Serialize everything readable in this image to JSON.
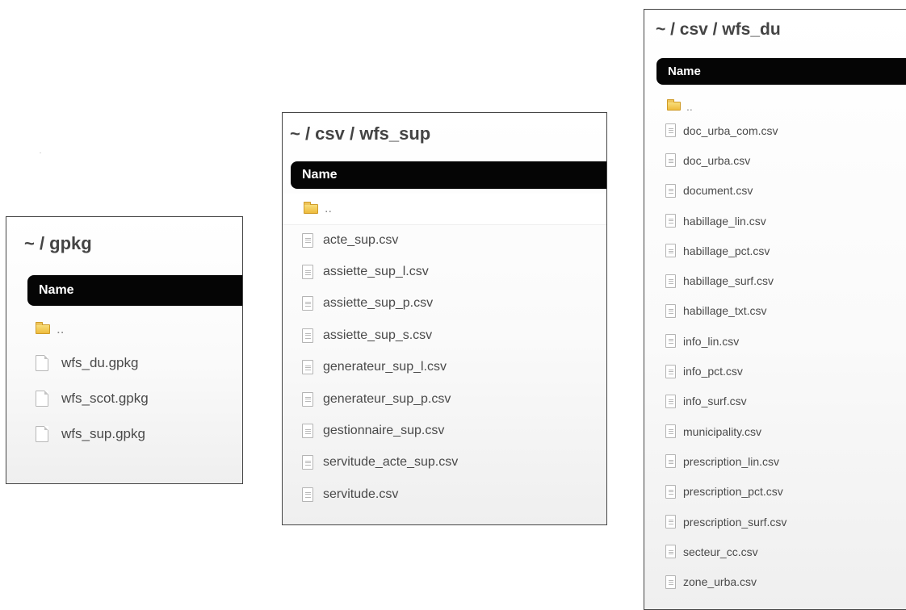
{
  "panels": {
    "gpkg": {
      "title": "~ / gpkg",
      "column_header": "Name",
      "parent_label": "..",
      "files": [
        "wfs_du.gpkg",
        "wfs_scot.gpkg",
        "wfs_sup.gpkg"
      ],
      "file_icon": "blank-file-icon"
    },
    "wfs_sup": {
      "title": "~ / csv / wfs_sup",
      "column_header": "Name",
      "parent_label": "..",
      "files": [
        "acte_sup.csv",
        "assiette_sup_l.csv",
        "assiette_sup_p.csv",
        "assiette_sup_s.csv",
        "generateur_sup_l.csv",
        "generateur_sup_p.csv",
        "gestionnaire_sup.csv",
        "servitude_acte_sup.csv",
        "servitude.csv"
      ],
      "file_icon": "text-file-icon"
    },
    "wfs_du": {
      "title": "~ / csv / wfs_du",
      "column_header": "Name",
      "parent_label": "..",
      "files": [
        "doc_urba_com.csv",
        "doc_urba.csv",
        "document.csv",
        "habillage_lin.csv",
        "habillage_pct.csv",
        "habillage_surf.csv",
        "habillage_txt.csv",
        "info_lin.csv",
        "info_pct.csv",
        "info_surf.csv",
        "municipality.csv",
        "prescription_lin.csv",
        "prescription_pct.csv",
        "prescription_surf.csv",
        "secteur_cc.csv",
        "zone_urba.csv"
      ],
      "file_icon": "text-file-icon"
    }
  },
  "colors": {
    "header_bar": "#050505",
    "title_text": "#444444",
    "folder": "#eebb3c"
  }
}
